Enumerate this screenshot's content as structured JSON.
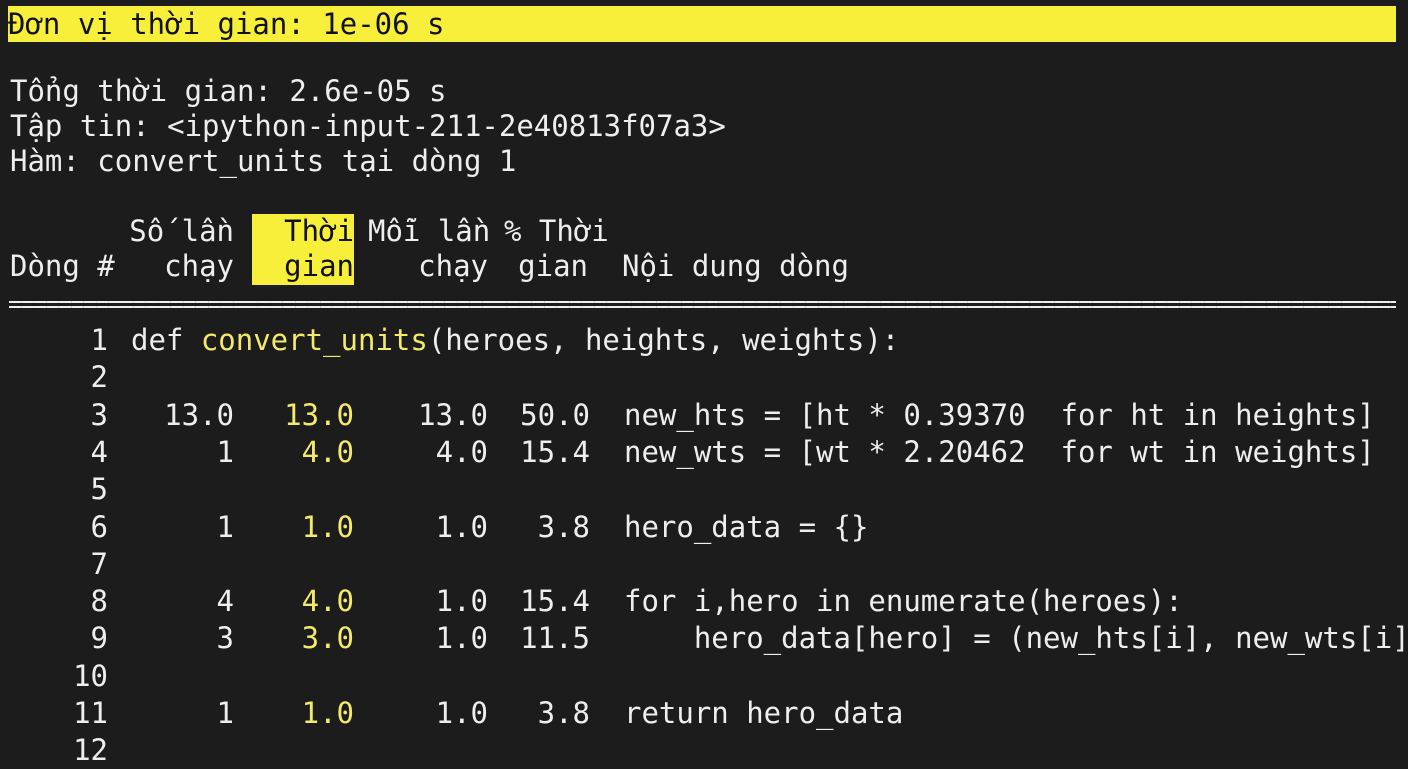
{
  "header": {
    "unit_line": "Đơn vị thời gian: 1e-06 s",
    "total_line": "Tổng thời gian: 2.6e-05 s",
    "file_line": "Tập tin: <ipython-input-211-2e40813f07a3>",
    "func_line": "Hàm: convert_units tại dòng 1"
  },
  "columns": {
    "line_no": "Dòng #",
    "hits_1": "Số lần",
    "hits_2": "chạy",
    "time_1": "Thời",
    "time_2": "gian",
    "per_hit_1": "Mỗi lần",
    "per_hit_2": "chạy",
    "pct_1": "% Thời",
    "pct_2": "gian",
    "contents": "Nội dung dòng"
  },
  "separator": "==========================================================================================================================================================",
  "rows": [
    {
      "line": "1",
      "hits": "",
      "time": "",
      "per_hit": "",
      "pct": "",
      "code_prefix": "def ",
      "code_func": "convert_units",
      "code_rest": "(heroes, heights, weights):"
    },
    {
      "line": "2",
      "hits": "",
      "time": "",
      "per_hit": "",
      "pct": "",
      "code": ""
    },
    {
      "line": "3",
      "hits": "13.0",
      "time": "13.0",
      "per_hit": "13.0",
      "pct": "50.0",
      "code": "new_hts = [ht * 0.39370  for ht in heights]"
    },
    {
      "line": "4",
      "hits": "1",
      "time": "4.0",
      "per_hit": "4.0",
      "pct": "15.4",
      "code": "new_wts = [wt * 2.20462  for wt in weights]"
    },
    {
      "line": "5",
      "hits": "",
      "time": "",
      "per_hit": "",
      "pct": "",
      "code": ""
    },
    {
      "line": "6",
      "hits": "1",
      "time": "1.0",
      "per_hit": "1.0",
      "pct": "3.8",
      "code": "hero_data = {}"
    },
    {
      "line": "7",
      "hits": "",
      "time": "",
      "per_hit": "",
      "pct": "",
      "code": ""
    },
    {
      "line": "8",
      "hits": "4",
      "time": "4.0",
      "per_hit": "1.0",
      "pct": "15.4",
      "code": "for i,hero in enumerate(heroes):"
    },
    {
      "line": "9",
      "hits": "3",
      "time": "3.0",
      "per_hit": "1.0",
      "pct": "11.5",
      "code": "    hero_data[hero] = (new_hts[i], new_wts[i])"
    },
    {
      "line": "10",
      "hits": "",
      "time": "",
      "per_hit": "",
      "pct": "",
      "code": ""
    },
    {
      "line": "11",
      "hits": "1",
      "time": "1.0",
      "per_hit": "1.0",
      "pct": "3.8",
      "code": "return hero_data"
    },
    {
      "line": "12",
      "hits": "",
      "time": "",
      "per_hit": "",
      "pct": "",
      "code": ""
    }
  ],
  "colors": {
    "background": "#1c1c1c",
    "highlight": "#f7ef3a",
    "time_column_text": "#f3e96b",
    "text": "#eeeeee"
  }
}
